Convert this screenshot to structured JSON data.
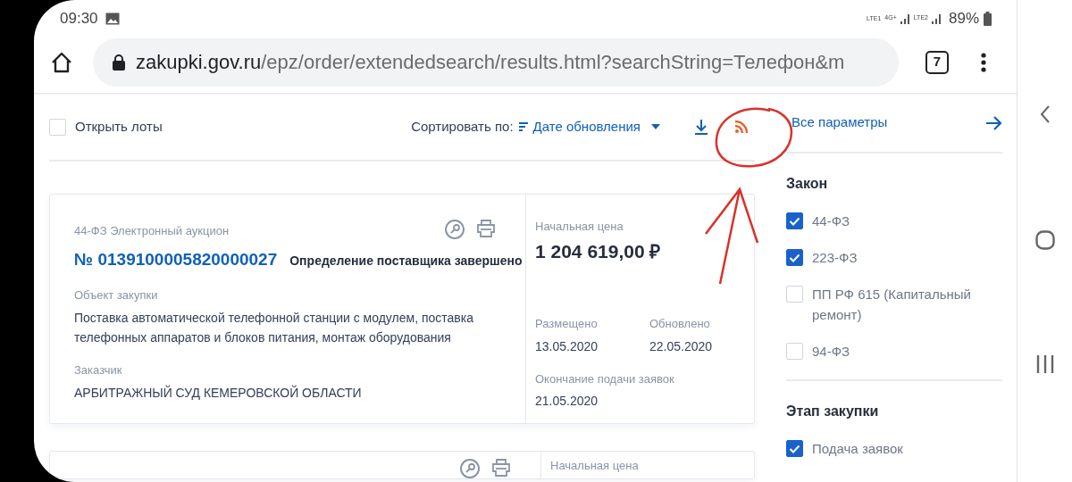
{
  "status_bar": {
    "time": "09:30",
    "sim1": "LTE1",
    "sim2": "LTE2",
    "network": "4G+",
    "battery": "89%"
  },
  "browser": {
    "url": {
      "host": "zakupki.gov.ru",
      "path": "/epz/order/extendedsearch/results.html?searchString=Телефон&m"
    },
    "tab_count": "7"
  },
  "toolbar": {
    "open_lots": {
      "label": "Открыть лоты",
      "checked": false
    },
    "sort_label": "Сортировать по:",
    "sort_value": "Дате обновления"
  },
  "results": [
    {
      "type_label": "44-ФЗ Электронный аукцион",
      "number": "№ 0139100005820000027",
      "status": "Определение поставщика завершено",
      "object_label": "Объект закупки",
      "object": "Поставка автоматической телефонной станции с модулем,  поставка телефонных аппаратов и блоков питания, монтаж оборудования",
      "customer_label": "Заказчик",
      "customer": "АРБИТРАЖНЫЙ СУД КЕМЕРОВСКОЙ ОБЛАСТИ",
      "price_label": "Начальная цена",
      "price": "1 204 619,00 ₽",
      "posted_label": "Размещено",
      "posted": "13.05.2020",
      "updated_label": "Обновлено",
      "updated": "22.05.2020",
      "deadline_label": "Окончание подачи заявок",
      "deadline": "21.05.2020"
    },
    {
      "price_label": "Начальная цена"
    }
  ],
  "filters": {
    "all_params": "Все параметры",
    "groups": [
      {
        "title": "Закон",
        "items": [
          {
            "label": "44-ФЗ",
            "checked": true
          },
          {
            "label": "223-ФЗ",
            "checked": true
          },
          {
            "label": "ПП РФ 615 (Капитальный ремонт)",
            "checked": false
          },
          {
            "label": "94-ФЗ",
            "checked": false
          }
        ]
      },
      {
        "title": "Этап закупки",
        "items": [
          {
            "label": "Подача заявок",
            "checked": true
          }
        ]
      }
    ]
  },
  "annotations": [
    {
      "kind": "circle"
    },
    {
      "kind": "arrow"
    }
  ]
}
